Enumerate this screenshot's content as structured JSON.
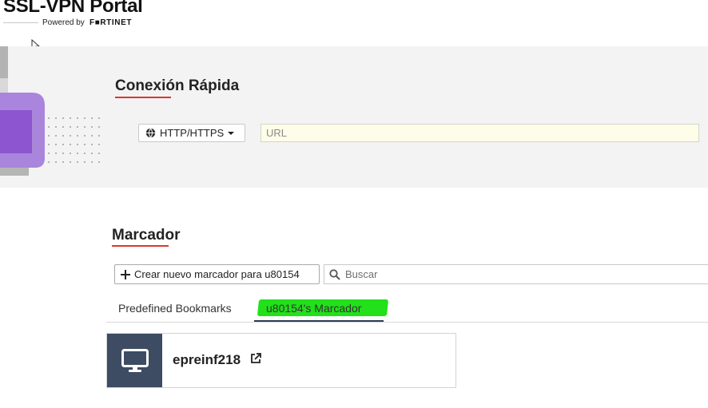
{
  "header": {
    "title": "SSL-VPN Portal",
    "powered_by": "Powered by",
    "vendor": "F■RTINET"
  },
  "quick_connection": {
    "title": "Conexión Rápida",
    "protocol_label": "HTTP/HTTPS",
    "url_placeholder": "URL",
    "url_value": ""
  },
  "bookmarks": {
    "title": "Marcador",
    "create_label": "Crear nuevo marcador para u80154",
    "search_placeholder": "Buscar",
    "tabs": [
      {
        "label": "Predefined Bookmarks",
        "active": false
      },
      {
        "label": "u80154's Marcador",
        "active": true
      }
    ],
    "items": [
      {
        "name": "epreinf218",
        "icon": "monitor-icon"
      }
    ]
  },
  "colors": {
    "accent_red": "#d9382e",
    "bookmark_icon_bg": "#3d4b63",
    "highlight_green": "#22e01a",
    "band_bg": "#f3f3f3",
    "decor_purple": "#9b6bd6"
  }
}
